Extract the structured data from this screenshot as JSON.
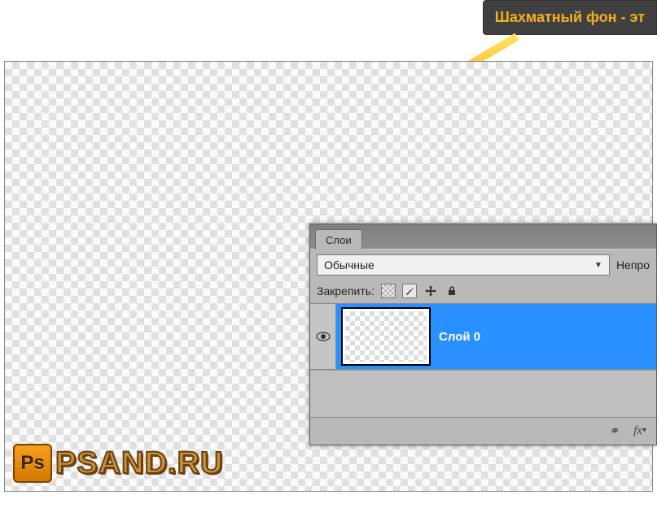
{
  "tooltip": {
    "text": "Шахматный фон - эт"
  },
  "watermark": {
    "icon_text": "Ps",
    "text": "PSAND.RU"
  },
  "layers_panel": {
    "tab_label": "Слои",
    "blend_mode": "Обычные",
    "opacity_label": "Непро",
    "lock_label": "Закрепить:",
    "layer": {
      "name": "Слой 0"
    },
    "footer": {
      "link_icon": "⚭",
      "fx_label": "fx"
    }
  }
}
